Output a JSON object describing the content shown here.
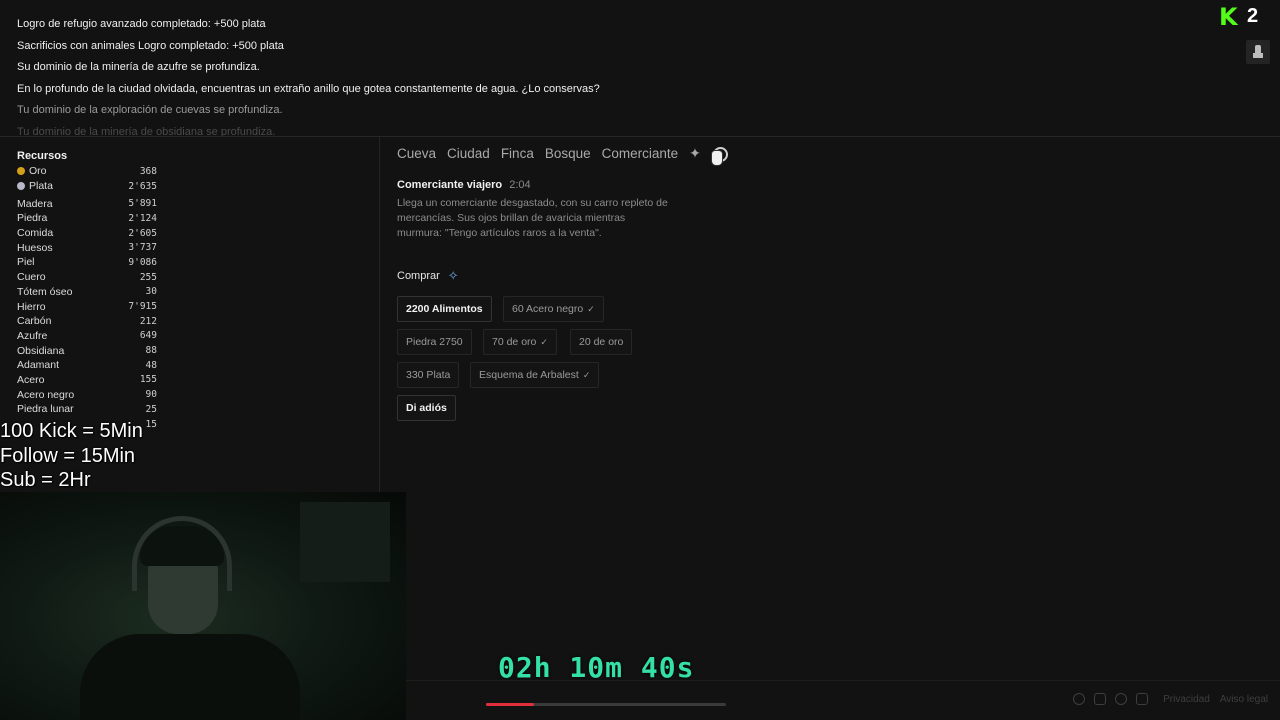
{
  "log": [
    {
      "text": "Logro de refugio avanzado completado: +500 plata",
      "style": "bright"
    },
    {
      "text": "Sacrificios con animales Logro completado: +500 plata",
      "style": "bright"
    },
    {
      "text": "Su dominio de la minería de azufre se profundiza.",
      "style": "bright"
    },
    {
      "text": "En lo profundo de la ciudad olvidada, encuentras un extraño anillo que gotea constantemente de agua. ¿Lo conservas?",
      "style": "bright"
    },
    {
      "text": "Tu dominio de la exploración de cuevas se profundiza.",
      "style": "dim1"
    },
    {
      "text": "Tu dominio de la minería de obsidiana se profundiza.",
      "style": "dim2"
    }
  ],
  "resources": {
    "title": "Recursos",
    "currency": [
      {
        "name": "Oro",
        "value": "368",
        "color": "#d4a017"
      },
      {
        "name": "Plata",
        "value": "2'635",
        "color": "#b8b8c8"
      }
    ],
    "items": [
      {
        "name": "Madera",
        "value": "5'891"
      },
      {
        "name": "Piedra",
        "value": "2'124"
      },
      {
        "name": "Comida",
        "value": "2'605"
      },
      {
        "name": "Huesos",
        "value": "3'737"
      },
      {
        "name": "Piel",
        "value": "9'086"
      },
      {
        "name": "Cuero",
        "value": "255"
      },
      {
        "name": "Tótem óseo",
        "value": "30"
      },
      {
        "name": "Hierro",
        "value": "7'915"
      },
      {
        "name": "Carbón",
        "value": "212"
      },
      {
        "name": "Azufre",
        "value": "649"
      },
      {
        "name": "Obsidiana",
        "value": "88"
      },
      {
        "name": "Adamant",
        "value": "48"
      },
      {
        "name": "Acero",
        "value": "155"
      },
      {
        "name": "Acero negro",
        "value": "90"
      },
      {
        "name": "Piedra lunar",
        "value": "25"
      },
      {
        "name": "",
        "value": "15"
      }
    ]
  },
  "tabs": {
    "items": [
      "Cueva",
      "Ciudad",
      "Finca",
      "Bosque",
      "Comerciante"
    ],
    "plus_icon": "plus-icon",
    "settings_icon": "settings-icon"
  },
  "merchant": {
    "title": "Comerciante viajero",
    "time": "2:04",
    "description": "Llega un comerciante desgastado, con su carro repleto de mercancías. Sus ojos brillan de avaricia mientras murmura: \"Tengo artículos raros a la venta\"."
  },
  "buy": {
    "label": "Comprar",
    "icon": "sparkle-icon",
    "rows": [
      [
        {
          "label": "2200 Alimentos",
          "active": true,
          "checked": false
        },
        {
          "label": "60 Acero negro",
          "active": false,
          "checked": true
        }
      ],
      [
        {
          "label": "Piedra 2750",
          "active": false,
          "checked": false
        },
        {
          "label": "70 de oro",
          "active": false,
          "checked": true
        },
        {
          "label": "20 de oro",
          "active": false,
          "checked": false
        }
      ],
      [
        {
          "label": "330 Plata",
          "active": false,
          "checked": false
        },
        {
          "label": "Esquema de Arbalest",
          "active": false,
          "checked": true
        }
      ]
    ],
    "farewell": "Di adiós"
  },
  "overlay": {
    "lines": [
      "100 Kick = 5Min",
      "Follow = 15Min",
      "Sub = 2Hr"
    ],
    "timer": "02h 10m 40s",
    "progress": 0.2
  },
  "badge": {
    "logo": "K",
    "count": "2",
    "accent": "#53fc18"
  },
  "footer": {
    "icons": [
      "reddit-icon",
      "instagram-icon",
      "discord-icon",
      "mail-icon"
    ],
    "links": [
      "Privacidad",
      "Aviso legal"
    ]
  }
}
